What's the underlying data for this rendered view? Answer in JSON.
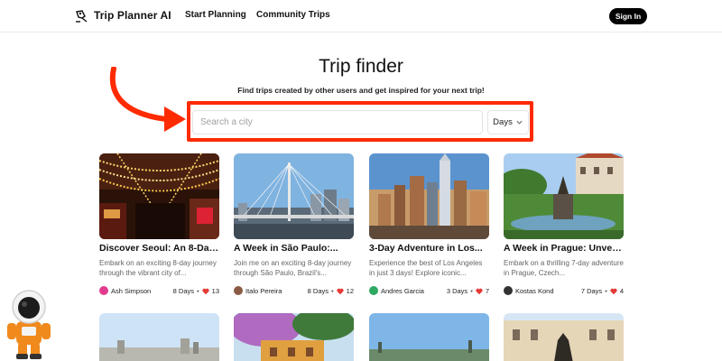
{
  "header": {
    "brand": "Trip Planner AI",
    "nav": {
      "start_planning": "Start Planning",
      "community_trips": "Community Trips"
    },
    "sign_in": "Sign In"
  },
  "hero": {
    "title": "Trip finder",
    "subtitle": "Find trips created by other users and get inspired for your next trip!"
  },
  "search": {
    "placeholder": "Search a city",
    "value": "",
    "days_label": "Days"
  },
  "cards": [
    {
      "title": "Discover Seoul: An 8-Day...",
      "desc": "Embark on an exciting 8-day journey through the vibrant city of...",
      "author": "Ash Simpson",
      "days": "8 Days",
      "likes": "13",
      "avatar_color": "#e23c8f",
      "avatar_letter": "A"
    },
    {
      "title": "A Week in São Paulo:...",
      "desc": "Join me on an exciting 8-day journey through São Paulo, Brazil's...",
      "author": "Italo Pereira",
      "days": "8 Days",
      "likes": "12",
      "avatar_color": "#8a5a44",
      "avatar_letter": ""
    },
    {
      "title": "3-Day Adventure in Los...",
      "desc": "Experience the best of Los Angeles in just 3 days! Explore iconic...",
      "author": "Andres Garcia",
      "days": "3 Days",
      "likes": "7",
      "avatar_color": "#2fa862",
      "avatar_letter": "A"
    },
    {
      "title": "A Week in Prague: Unveilin...",
      "desc": "Embark on a thrilling 7-day adventure in Prague, Czech...",
      "author": "Kostas Kond",
      "days": "7 Days",
      "likes": "4",
      "avatar_color": "#333333",
      "avatar_letter": ""
    }
  ],
  "colors": {
    "highlight": "#ff2b00",
    "heart": "#e53935",
    "accent": "#000000"
  }
}
